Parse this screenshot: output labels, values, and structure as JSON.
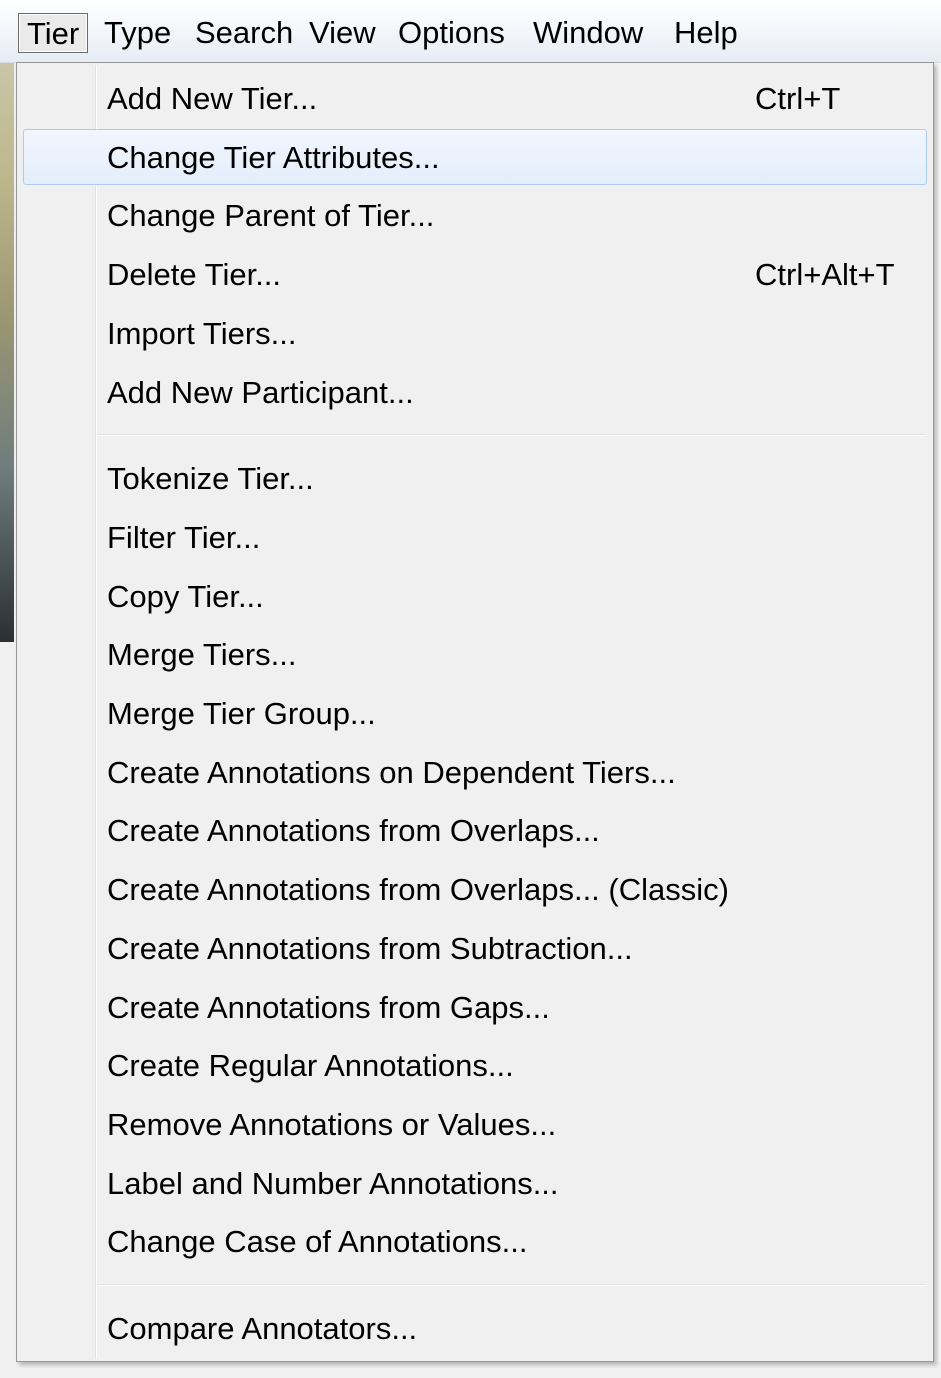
{
  "menubar": {
    "items": [
      "Tier",
      "Type",
      "Search",
      "View",
      "Options",
      "Window",
      "Help"
    ]
  },
  "tier_menu": {
    "groups": [
      [
        {
          "label": "Add New Tier...",
          "shortcut": "Ctrl+T"
        },
        {
          "label": "Change Tier Attributes...",
          "shortcut": "",
          "highlighted": true
        },
        {
          "label": "Change Parent of Tier...",
          "shortcut": ""
        },
        {
          "label": "Delete Tier...",
          "shortcut": "Ctrl+Alt+T"
        },
        {
          "label": "Import Tiers...",
          "shortcut": ""
        },
        {
          "label": "Add New Participant...",
          "shortcut": ""
        }
      ],
      [
        {
          "label": "Tokenize Tier...",
          "shortcut": ""
        },
        {
          "label": "Filter Tier...",
          "shortcut": ""
        },
        {
          "label": "Copy Tier...",
          "shortcut": ""
        },
        {
          "label": "Merge Tiers...",
          "shortcut": ""
        },
        {
          "label": "Merge Tier Group...",
          "shortcut": ""
        },
        {
          "label": "Create Annotations on Dependent Tiers...",
          "shortcut": ""
        },
        {
          "label": "Create Annotations from Overlaps...",
          "shortcut": ""
        },
        {
          "label": "Create Annotations from Overlaps... (Classic)",
          "shortcut": ""
        },
        {
          "label": "Create Annotations from Subtraction...",
          "shortcut": ""
        },
        {
          "label": "Create Annotations from Gaps...",
          "shortcut": ""
        },
        {
          "label": "Create Regular Annotations...",
          "shortcut": ""
        },
        {
          "label": "Remove Annotations or Values...",
          "shortcut": ""
        },
        {
          "label": "Label and Number Annotations...",
          "shortcut": ""
        },
        {
          "label": "Change Case of Annotations...",
          "shortcut": ""
        }
      ],
      [
        {
          "label": "Compare Annotators...",
          "shortcut": ""
        }
      ]
    ]
  },
  "colors": {
    "menu_bg": "#f0f0f0",
    "highlight_border": "#aeccf2",
    "highlight_bg": "#e4eefc"
  }
}
